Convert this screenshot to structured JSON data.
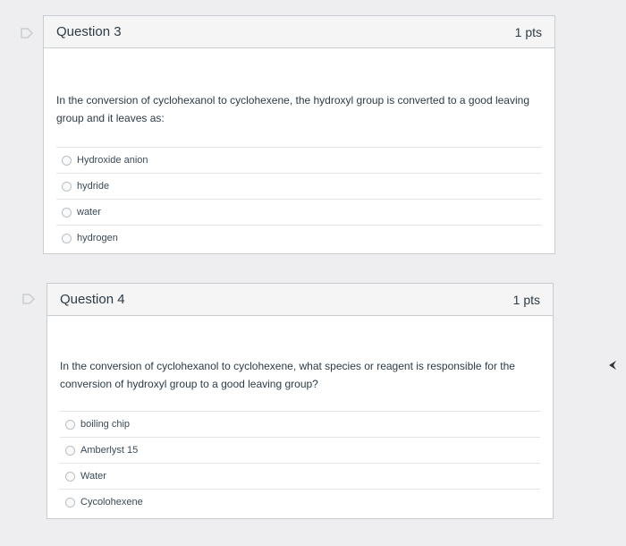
{
  "questions": [
    {
      "title": "Question 3",
      "points": "1 pts",
      "text": "In the conversion of cyclohexanol to cyclohexene, the hydroxyl group is converted to a good leaving group and it leaves as:",
      "answers": [
        "Hydroxide anion",
        "hydride",
        "water",
        "hydrogen"
      ]
    },
    {
      "title": "Question 4",
      "points": "1 pts",
      "text": "In the conversion of cyclohexanol to cyclohexene, what species or reagent is responsible for the conversion of hydroxyl group to a good leaving group?",
      "answers": [
        "boiling chip",
        "Amberlyst 15",
        "Water",
        "Cycolohexene"
      ]
    }
  ],
  "icons": {
    "flag": "flag-icon",
    "cursor": "mouse-cursor-icon"
  },
  "colors": {
    "border": "#c7cdd1",
    "header_bg": "#f5f5f5",
    "text": "#2d3b45"
  }
}
